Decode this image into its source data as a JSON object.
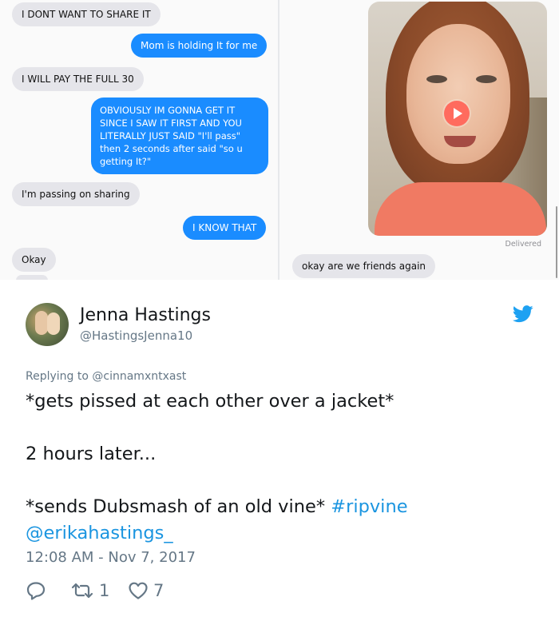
{
  "left_chat": {
    "messages": [
      {
        "text": "I DONT WANT TO SHARE IT"
      },
      {
        "text": "Mom is holding It for me"
      },
      {
        "text": "I WILL PAY THE FULL 30"
      },
      {
        "text": "OBVIOUSLY IM GONNA GET IT SINCE I SAW IT FIRST AND YOU LITERALLY JUST SAID \"I'll pass\" then 2 seconds after said \"so u getting It?\""
      },
      {
        "text": "I'm passing on sharing"
      },
      {
        "text": "I KNOW THAT"
      },
      {
        "text": "Okay"
      }
    ]
  },
  "right_chat": {
    "status": "Delivered",
    "message": "okay are we friends again"
  },
  "tweet": {
    "name": "Jenna Hastings",
    "handle": "@HastingsJenna10",
    "replying_label": "Replying to",
    "replying_handle": "@cinnamxntxast",
    "line1": "*gets pissed at each other over a jacket*",
    "line2": "2 hours later...",
    "line3": "*sends Dubsmash of an old vine*",
    "hashtag": "#ripvine",
    "mention": "@erikahastings_",
    "timestamp": "12:08 AM - Nov 7, 2017",
    "retweets": "1",
    "likes": "7"
  },
  "colors": {
    "imessage_blue": "#1a8cff",
    "imessage_gray": "#e5e5ea",
    "twitter_blue": "#1da1f2",
    "link_blue": "#1b95e0",
    "muted": "#657786"
  },
  "icons": [
    "play-icon",
    "twitter-bird-icon",
    "reply-icon",
    "retweet-icon",
    "heart-icon"
  ]
}
